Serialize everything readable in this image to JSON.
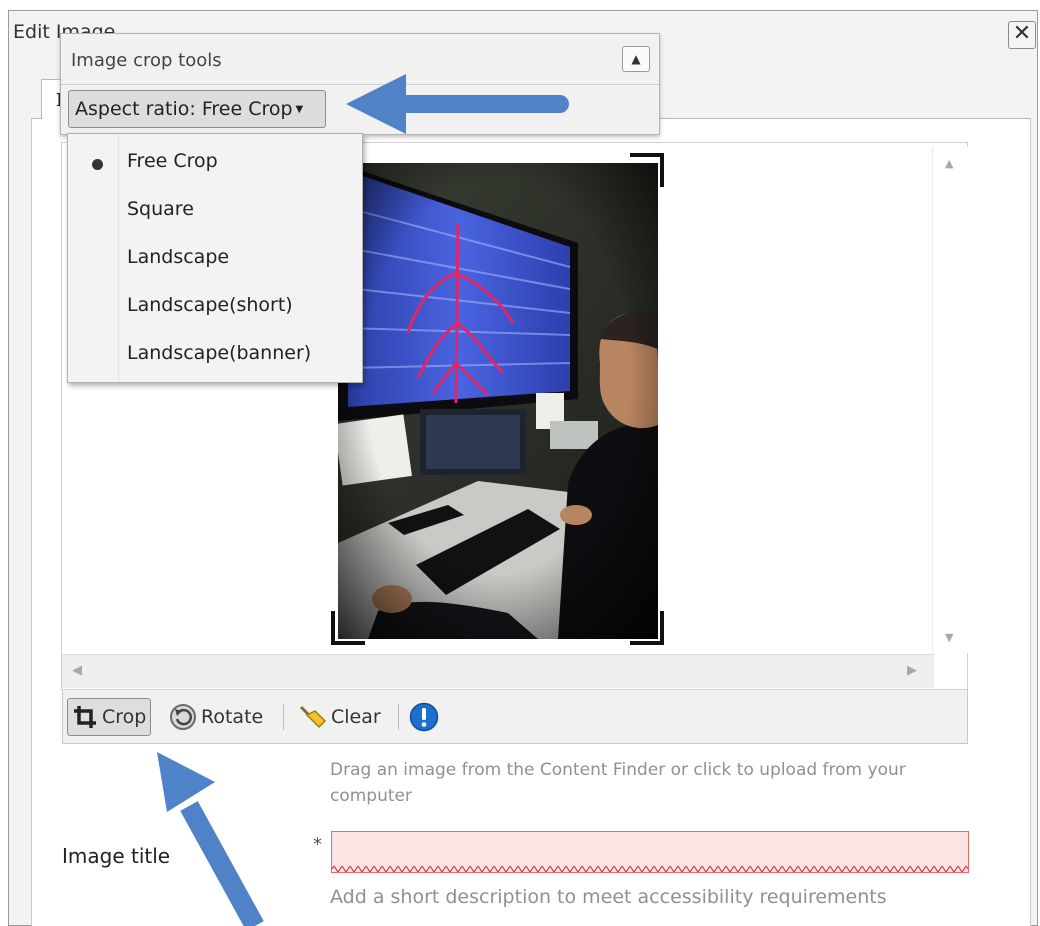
{
  "dialog": {
    "title": "Edit Image",
    "close_glyph": "✕",
    "tab_label": "I"
  },
  "crop_tools": {
    "title": "Image crop tools",
    "collapse_glyph": "▲",
    "aspect_label": "Aspect ratio: Free Crop",
    "aspect_caret": "▼",
    "options": [
      {
        "label": "Free Crop",
        "selected": true
      },
      {
        "label": "Square",
        "selected": false
      },
      {
        "label": "Landscape",
        "selected": false
      },
      {
        "label": "Landscape(short)",
        "selected": false
      },
      {
        "label": "Landscape(banner)",
        "selected": false
      }
    ]
  },
  "scroll": {
    "up": "▲",
    "down": "▼",
    "left": "◀",
    "right": "▶"
  },
  "toolbar": {
    "crop_label": "Crop",
    "rotate_label": "Rotate",
    "clear_label": "Clear",
    "icons": [
      "crop-icon",
      "rotate-icon",
      "clear-icon",
      "info-icon"
    ]
  },
  "upload_hint": "Drag an image from the Content Finder or click to upload from your computer",
  "image_title": {
    "label": "Image title",
    "required_marker": "*",
    "value": "",
    "hint": "Add a short description to meet accessibility requirements"
  },
  "colors": {
    "annotation_arrow": "#4f82c6",
    "input_error_bg": "#fde4e4",
    "input_error_border": "#e26b6b",
    "info_icon": "#1f6fcf"
  }
}
